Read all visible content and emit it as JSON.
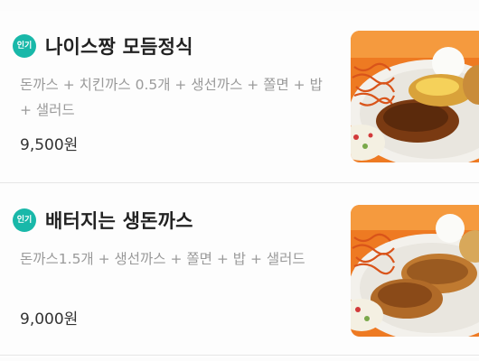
{
  "menu": {
    "items": [
      {
        "badge": "인기",
        "title": "나이스짱 모듬정식",
        "description": "돈까스 + 치킨까스 0.5개 + 생선까스 + 쫄면 + 밥 + 샐러드",
        "price": "9,500원",
        "image": "pork-cutlet-combo-plate-photo"
      },
      {
        "badge": "인기",
        "title": "배터지는 생돈까스",
        "description": "돈까스1.5개 + 생선까스 + 쫄면 + 밥 + 샐러드",
        "price": "9,000원",
        "image": "fresh-pork-cutlet-plate-photo"
      }
    ]
  },
  "colors": {
    "badge": "#19b8a9",
    "title": "#222222",
    "description": "#9a9a9a",
    "price": "#333333",
    "image_background": "#f07a1e"
  }
}
